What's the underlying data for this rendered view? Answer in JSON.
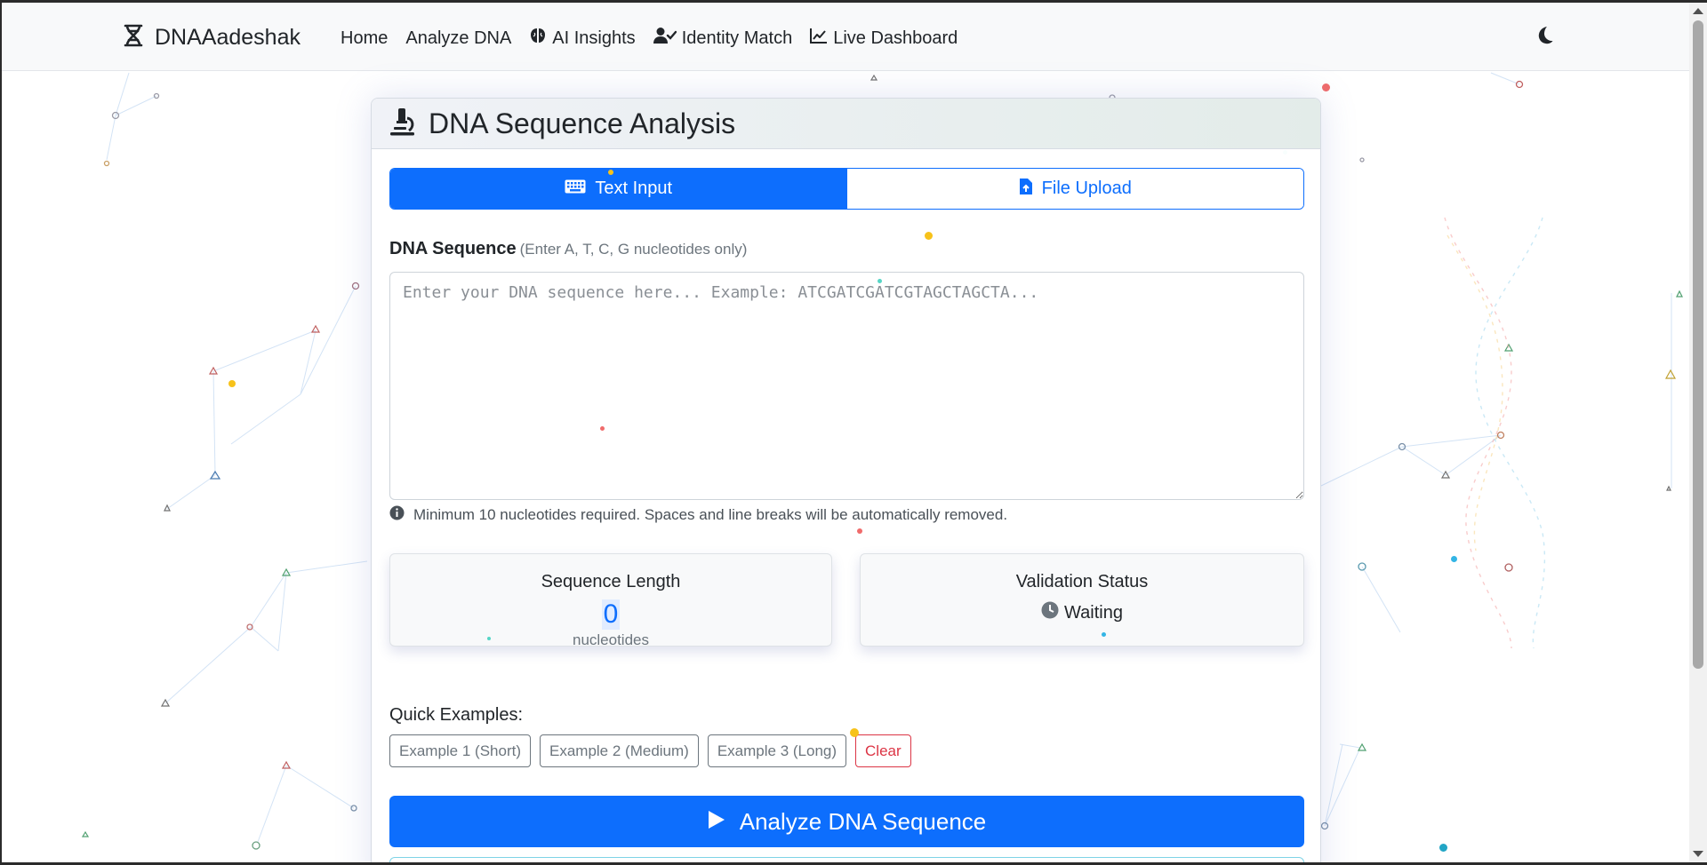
{
  "navbar": {
    "brand": "DNAAadeshak",
    "links": [
      {
        "label": "Home",
        "icon": ""
      },
      {
        "label": "Analyze DNA",
        "icon": ""
      },
      {
        "label": "AI Insights",
        "icon": "brain-icon"
      },
      {
        "label": "Identity Match",
        "icon": "user-check-icon"
      },
      {
        "label": "Live Dashboard",
        "icon": "chart-line-icon"
      }
    ],
    "theme_icon": "moon-icon"
  },
  "card": {
    "title": "DNA Sequence Analysis",
    "icon": "microscope-icon"
  },
  "tabs": [
    {
      "label": "Text Input",
      "icon": "keyboard-icon",
      "active": true
    },
    {
      "label": "File Upload",
      "icon": "file-upload-icon",
      "active": false
    }
  ],
  "sequence_field": {
    "label": "DNA Sequence",
    "hint": "(Enter A, T, C, G nucleotides only)",
    "value": "",
    "placeholder": "Enter your DNA sequence here... Example: ATCGATCGATCGTAGCTAGCTA...",
    "help": "Minimum 10 nucleotides required. Spaces and line breaks will be automatically removed."
  },
  "stats": {
    "length_title": "Sequence Length",
    "length_value": "0",
    "length_unit": "nucleotides",
    "validation_title": "Validation Status",
    "validation_value": "Waiting"
  },
  "quick_examples": {
    "label": "Quick Examples:",
    "buttons": [
      "Example 1 (Short)",
      "Example 2 (Medium)",
      "Example 3 (Long)"
    ],
    "clear": "Clear"
  },
  "analyze_button": "Analyze DNA Sequence",
  "colors": {
    "primary": "#0d6efd",
    "danger": "#dc3545",
    "secondary": "#6c757d",
    "navbar_bg": "#f8f9fa"
  }
}
